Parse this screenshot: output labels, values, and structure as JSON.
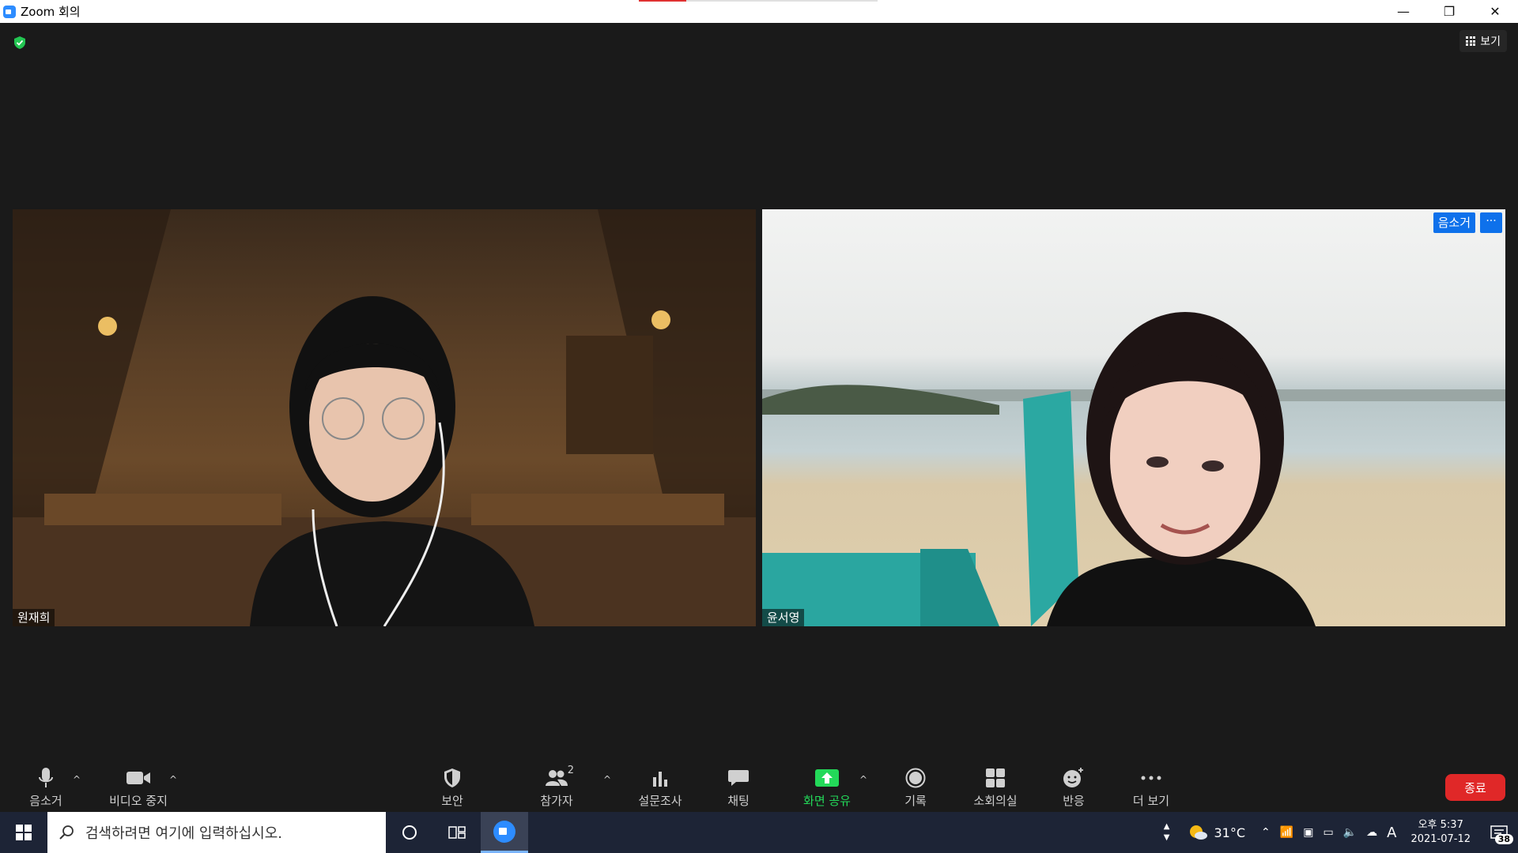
{
  "window": {
    "title": "Zoom 회의",
    "minimize": "—",
    "restore": "❐",
    "close": "✕"
  },
  "meeting": {
    "view_label": "보기",
    "participants": [
      {
        "name": "원재희"
      },
      {
        "name": "윤서영",
        "mute_label": "음소거",
        "more_label": "···"
      }
    ]
  },
  "toolbar": {
    "mute": "음소거",
    "video": "비디오 중지",
    "security": "보안",
    "participants": "참가자",
    "participant_count": "2",
    "polls": "설문조사",
    "chat": "채팅",
    "share": "화면 공유",
    "record": "기록",
    "breakout": "소회의실",
    "reactions": "반응",
    "more": "더 보기",
    "end": "종료",
    "share_color": "#23d959",
    "end_color": "#e02828"
  },
  "taskbar": {
    "search_placeholder": "검색하려면 여기에 입력하십시오.",
    "weather": "31°C",
    "ime": "A",
    "time": "오후 5:37",
    "date": "2021-07-12",
    "notification_count": "38"
  }
}
